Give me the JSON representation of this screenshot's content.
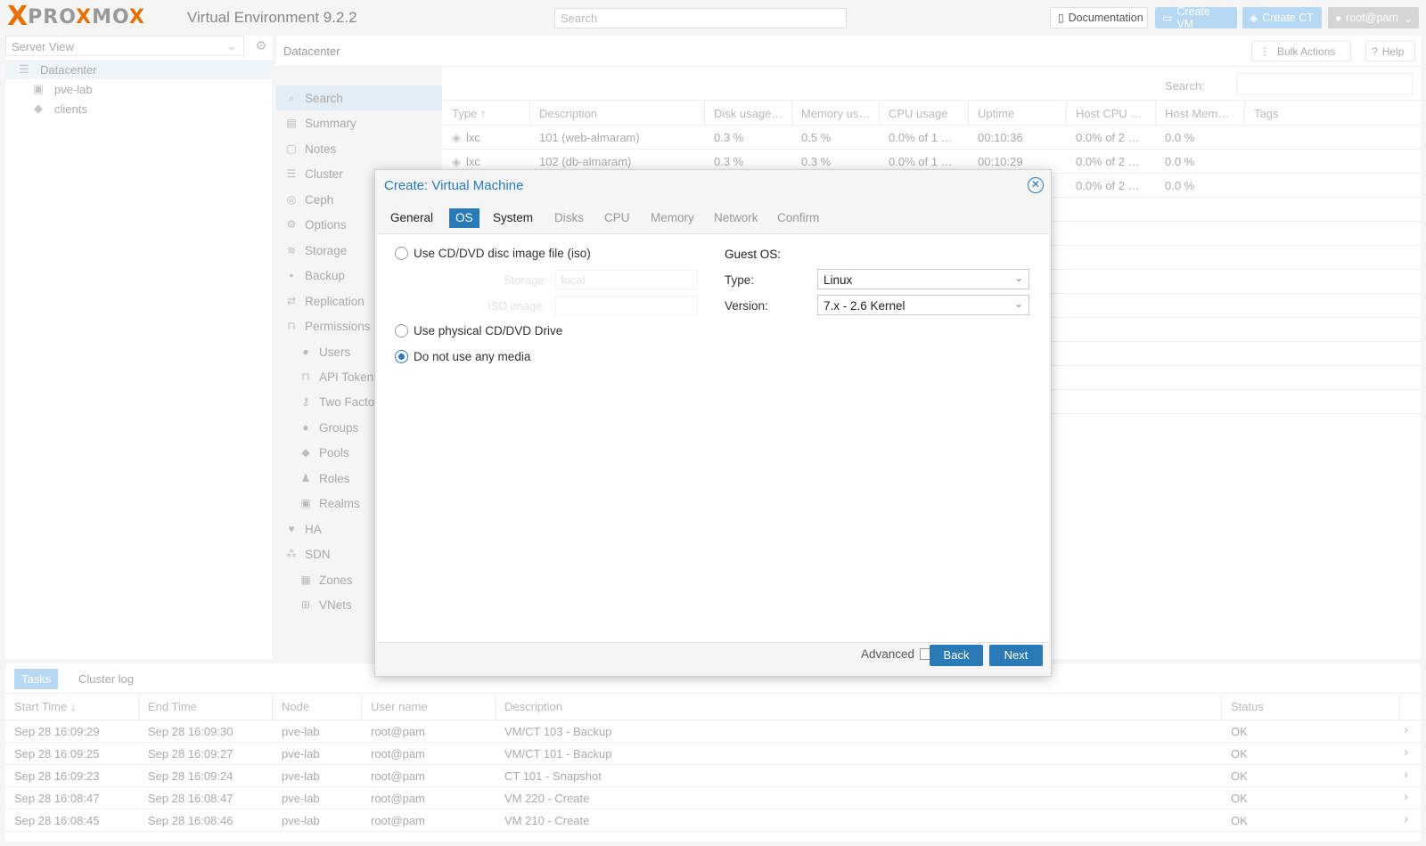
{
  "header": {
    "logo_x": "X",
    "logo_part1": "PRO",
    "logo_x2": "X",
    "logo_part2": "MO",
    "logo_x3": "X",
    "version": "Virtual Environment 9.2.2",
    "search_placeholder": "Search",
    "documentation": "Documentation",
    "create_vm": "Create VM",
    "create_ct": "Create CT",
    "user": "root@pam"
  },
  "tree": {
    "view_select": "Server View",
    "items": [
      {
        "label": "Datacenter",
        "icon": "server-icon"
      },
      {
        "label": "pve-lab",
        "icon": "node-icon"
      },
      {
        "label": "clients",
        "icon": "tags-icon"
      }
    ]
  },
  "center": {
    "title": "Datacenter",
    "bulk_actions": "Bulk Actions",
    "help": "Help",
    "grid_search_label": "Search:"
  },
  "nav": [
    {
      "label": "Search",
      "icon": "search-icon",
      "sub": false
    },
    {
      "label": "Summary",
      "icon": "book-icon",
      "sub": false
    },
    {
      "label": "Notes",
      "icon": "note-icon",
      "sub": false
    },
    {
      "label": "Cluster",
      "icon": "server-icon",
      "sub": false
    },
    {
      "label": "Ceph",
      "icon": "ceph-icon",
      "sub": false
    },
    {
      "label": "Options",
      "icon": "gear-icon",
      "sub": false
    },
    {
      "label": "Storage",
      "icon": "database-icon",
      "sub": false
    },
    {
      "label": "Backup",
      "icon": "floppy-icon",
      "sub": false
    },
    {
      "label": "Replication",
      "icon": "retweet-icon",
      "sub": false
    },
    {
      "label": "Permissions",
      "icon": "unlock-icon",
      "sub": false
    },
    {
      "label": "Users",
      "icon": "user-icon",
      "sub": true
    },
    {
      "label": "API Tokens",
      "icon": "lock-icon",
      "sub": true
    },
    {
      "label": "Two Factor",
      "icon": "key-icon",
      "sub": true
    },
    {
      "label": "Groups",
      "icon": "users-icon",
      "sub": true
    },
    {
      "label": "Pools",
      "icon": "tags-icon",
      "sub": true
    },
    {
      "label": "Roles",
      "icon": "male-icon",
      "sub": true
    },
    {
      "label": "Realms",
      "icon": "address-book-icon",
      "sub": true
    },
    {
      "label": "HA",
      "icon": "heartbeat-icon",
      "sub": false
    },
    {
      "label": "SDN",
      "icon": "network-icon",
      "sub": false
    },
    {
      "label": "Zones",
      "icon": "grid-icon",
      "sub": true
    },
    {
      "label": "VNets",
      "icon": "sitemap-icon",
      "sub": true
    }
  ],
  "grid": {
    "columns": [
      "Type ↑",
      "Description",
      "Disk usage…",
      "Memory us…",
      "CPU usage",
      "Uptime",
      "Host CPU …",
      "Host Mem…",
      "Tags"
    ],
    "rows": [
      {
        "type": "lxc",
        "description": "101 (web-almaram)",
        "disk": "0.3 %",
        "memory": "0.5 %",
        "cpu": "0.0% of 1 …",
        "uptime": "00:10:36",
        "host_cpu": "0.0% of 2 …",
        "host_mem": "0.0 %"
      },
      {
        "type": "lxc",
        "description": "102 (db-almaram)",
        "disk": "0.3 %",
        "memory": "0.3 %",
        "cpu": "0.0% of 1 …",
        "uptime": "00:10:29",
        "host_cpu": "0.0% of 2 …",
        "host_mem": "0.0 %"
      },
      {
        "type": "",
        "description": "",
        "disk": "",
        "memory": "",
        "cpu": "",
        "uptime": "",
        "host_cpu": "0.0% of 2 …",
        "host_mem": "0.0 %"
      }
    ]
  },
  "bottom": {
    "tabs": [
      "Tasks",
      "Cluster log"
    ],
    "columns": [
      "Start Time ↓",
      "End Time",
      "Node",
      "User name",
      "Description",
      "Status"
    ],
    "rows": [
      {
        "start": "Sep 28 16:09:29",
        "end": "Sep 28 16:09:30",
        "node": "pve-lab",
        "user": "root@pam",
        "desc": "VM/CT 103 - Backup",
        "status": "OK"
      },
      {
        "start": "Sep 28 16:09:25",
        "end": "Sep 28 16:09:27",
        "node": "pve-lab",
        "user": "root@pam",
        "desc": "VM/CT 101 - Backup",
        "status": "OK"
      },
      {
        "start": "Sep 28 16:09:23",
        "end": "Sep 28 16:09:24",
        "node": "pve-lab",
        "user": "root@pam",
        "desc": "CT 101 - Snapshot",
        "status": "OK"
      },
      {
        "start": "Sep 28 16:08:47",
        "end": "Sep 28 16:08:47",
        "node": "pve-lab",
        "user": "root@pam",
        "desc": "VM 220 - Create",
        "status": "OK"
      },
      {
        "start": "Sep 28 16:08:45",
        "end": "Sep 28 16:08:46",
        "node": "pve-lab",
        "user": "root@pam",
        "desc": "VM 210 - Create",
        "status": "OK"
      }
    ]
  },
  "modal": {
    "title": "Create: Virtual Machine",
    "tabs": [
      "General",
      "OS",
      "System",
      "Disks",
      "CPU",
      "Memory",
      "Network",
      "Confirm"
    ],
    "active_tab": "OS",
    "radio_iso": "Use CD/DVD disc image file (iso)",
    "storage_label": "Storage:",
    "storage_value": "local",
    "iso_label": "ISO image:",
    "radio_physical": "Use physical CD/DVD Drive",
    "radio_none": "Do not use any media",
    "selected_media": "none",
    "guest_os": "Guest OS:",
    "type_label": "Type:",
    "type_value": "Linux",
    "version_label": "Version:",
    "version_value": "7.x - 2.6 Kernel",
    "advanced": "Advanced",
    "back": "Back",
    "next": "Next"
  },
  "colors": {
    "accent": "#2a7ab8",
    "brand_orange": "#e57000"
  }
}
